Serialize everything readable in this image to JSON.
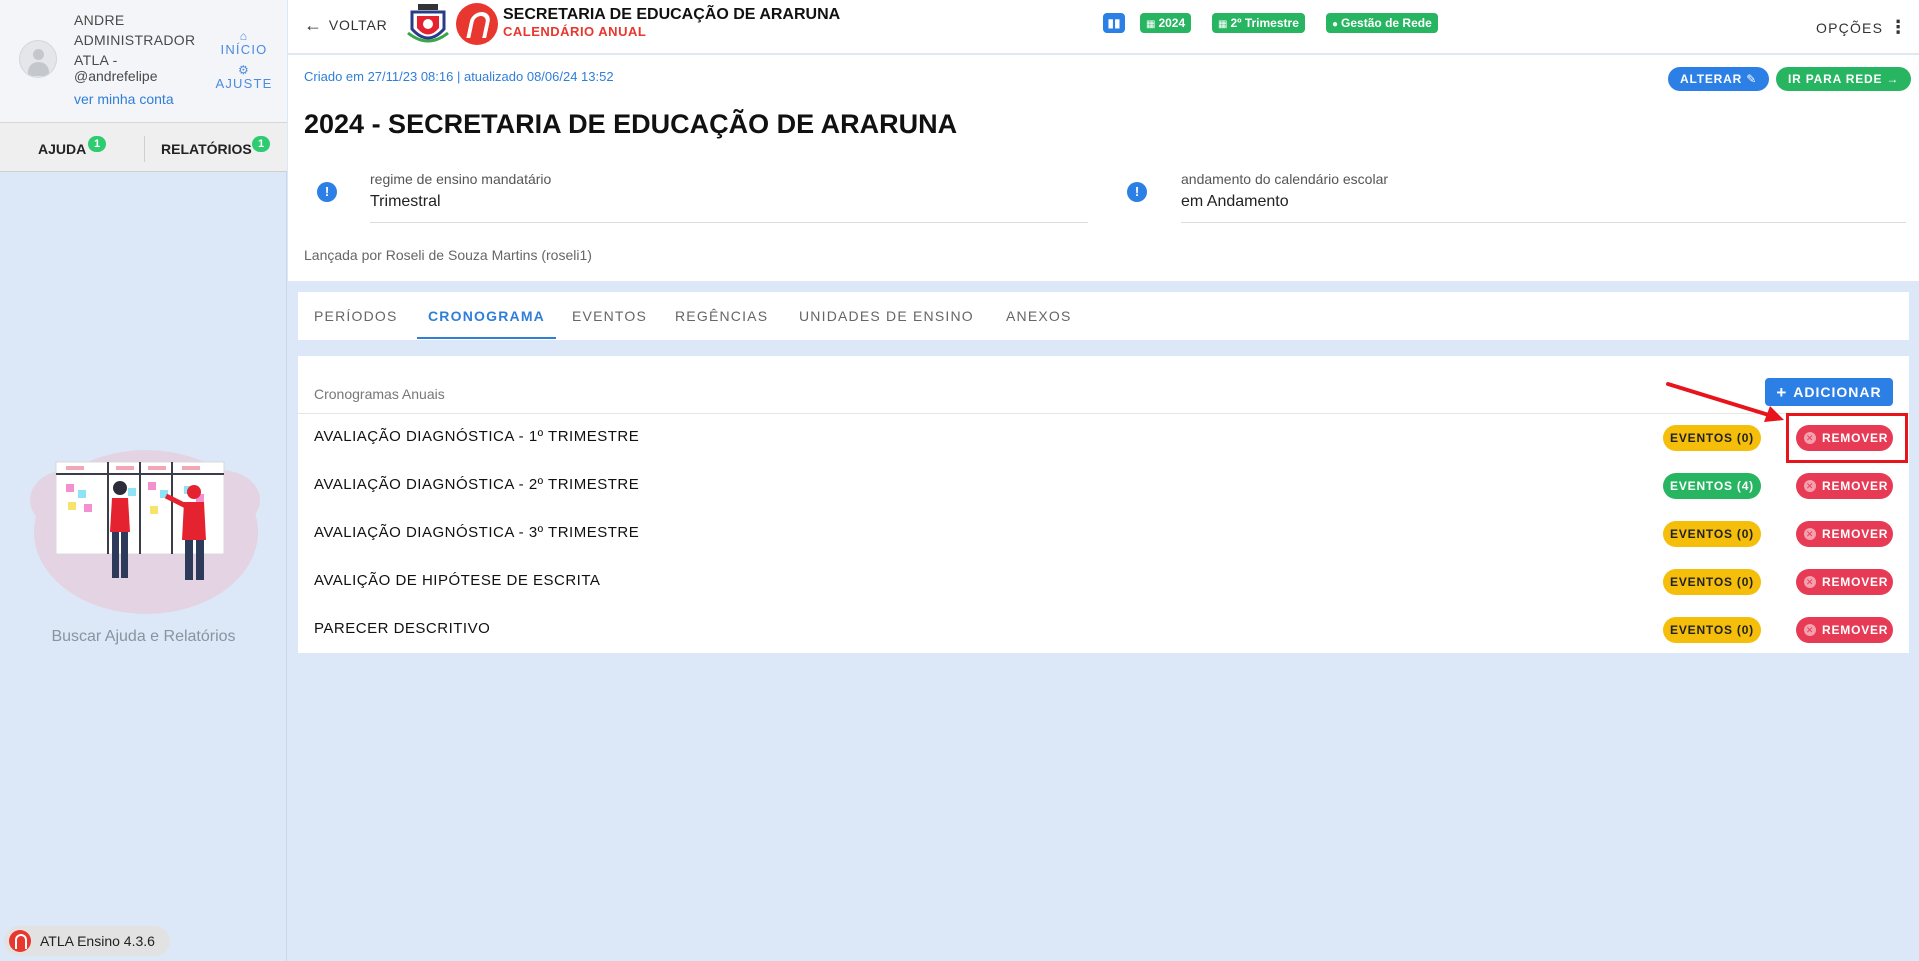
{
  "sidebar": {
    "user_name": "ANDRE ADMINISTRADOR ATLA -",
    "user_handle": "@andrefelipe",
    "account_link": "ver minha conta",
    "home_label": "INÍCIO",
    "settings_label": "AJUSTE",
    "help_label": "AJUDA",
    "help_count": "1",
    "reports_label": "RELATÓRIOS",
    "reports_count": "1",
    "help_caption": "Buscar Ajuda e Relatórios",
    "version": "ATLA Ensino 4.3.6"
  },
  "topbar": {
    "back_label": "VOLTAR",
    "org_title": "SECRETARIA DE EDUCAÇÃO DE ARARUNA",
    "org_subtitle": "CALENDÁRIO ANUAL",
    "year_badge": "2024",
    "quarter_badge": "2º Trimestre",
    "network_badge": "Gestão de Rede",
    "options_label": "OPÇÕES"
  },
  "info": {
    "created": "Criado em 27/11/23 08:16 | atualizado 08/06/24 13:52",
    "edit_label": "ALTERAR",
    "network_label": "IR PARA REDE",
    "title": "2024 - SECRETARIA DE EDUCAÇÃO DE ARARUNA",
    "regime_label": "regime de ensino mandatário",
    "regime_value": "Trimestral",
    "progress_label": "andamento do calendário escolar",
    "progress_value": "em Andamento",
    "released_by": "Lançada por Roseli de Souza Martins (roseli1)"
  },
  "tabs": [
    "PERÍODOS",
    "CRONOGRAMA",
    "EVENTOS",
    "REGÊNCIAS",
    "UNIDADES DE ENSINO",
    "ANEXOS"
  ],
  "schedules": {
    "header": "Cronogramas Anuais",
    "add_label": "ADICIONAR",
    "remove_label": "REMOVER",
    "rows": [
      {
        "name": "AVALIAÇÃO DIAGNÓSTICA - 1º TRIMESTRE",
        "events": "EVENTOS (0)",
        "status": "empty"
      },
      {
        "name": "AVALIAÇÃO DIAGNÓSTICA - 2º TRIMESTRE",
        "events": "EVENTOS (4)",
        "status": "filled"
      },
      {
        "name": "AVALIAÇÃO DIAGNÓSTICA - 3º TRIMESTRE",
        "events": "EVENTOS (0)",
        "status": "empty"
      },
      {
        "name": "AVALIÇÃO DE HIPÓTESE DE ESCRITA",
        "events": "EVENTOS (0)",
        "status": "empty"
      },
      {
        "name": "PARECER DESCRITIVO",
        "events": "EVENTOS (0)",
        "status": "empty"
      }
    ]
  },
  "colors": {
    "primary": "#2b7fe5",
    "success": "#27b561",
    "warning": "#f5be0b",
    "danger": "#e73a55",
    "brand": "#e8372e",
    "annotation": "#e8141c"
  },
  "icons": {
    "back": "arrow-left-icon",
    "home": "home-icon",
    "settings": "gear-icon",
    "stats": "bar-chart-icon",
    "calendar": "calendar-icon",
    "network": "check-circle-icon",
    "options": "more-vertical-icon",
    "info": "info-icon",
    "edit": "edit-icon",
    "go": "arrow-right-icon",
    "add": "plus-icon",
    "remove": "close-circle-icon"
  }
}
